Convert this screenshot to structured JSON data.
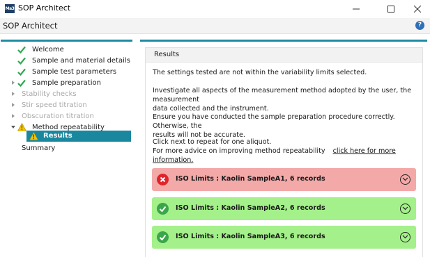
{
  "window": {
    "icon_text": "Ma3",
    "title": "SOP Architect"
  },
  "app": {
    "title": "SOP Architect",
    "help_symbol": "?"
  },
  "nav": {
    "items": [
      {
        "label": "Welcome",
        "state": "done"
      },
      {
        "label": "Sample and material details",
        "state": "done"
      },
      {
        "label": "Sample test parameters",
        "state": "done"
      },
      {
        "label": "Sample preparation",
        "state": "done"
      },
      {
        "label": "Stability checks",
        "state": "disabled"
      },
      {
        "label": "Stir speed titration",
        "state": "disabled"
      },
      {
        "label": "Obscuration titration",
        "state": "disabled"
      },
      {
        "label": "Method repeatability",
        "state": "warning"
      },
      {
        "label": "Results",
        "state": "selected-warning"
      },
      {
        "label": "Summary",
        "state": "plain"
      }
    ]
  },
  "panel": {
    "title": "Results",
    "p1": "The settings tested are not within the variability limits selected.",
    "p2_line1": "Investigate all aspects of the measurement method adopted by the user, the measurement",
    "p2_line2": "data collected and the instrument.",
    "p3_line1": "Ensure you have conducted the sample preparation procedure correctly. Otherwise, the",
    "p3_line2": "results will not be accurate.",
    "p4_line1": "Click next to repeat for one aliquot.",
    "p4_line2": "For more advice on improving method repeatability",
    "link": "click here for more information."
  },
  "results": [
    {
      "label": "ISO Limits : Kaolin SampleA1, 6 records",
      "status": "fail"
    },
    {
      "label": "ISO Limits : Kaolin SampleA2, 6 records",
      "status": "pass"
    },
    {
      "label": "ISO Limits : Kaolin SampleA3, 6 records",
      "status": "pass"
    }
  ],
  "colors": {
    "accent": "#1e8ba3",
    "fail_bg": "#f4a9a9",
    "pass_bg": "#a4f08a",
    "fail_icon": "#e0242b",
    "pass_icon": "#3aa64a",
    "check": "#2fa84f",
    "warning": "#f2c400"
  }
}
